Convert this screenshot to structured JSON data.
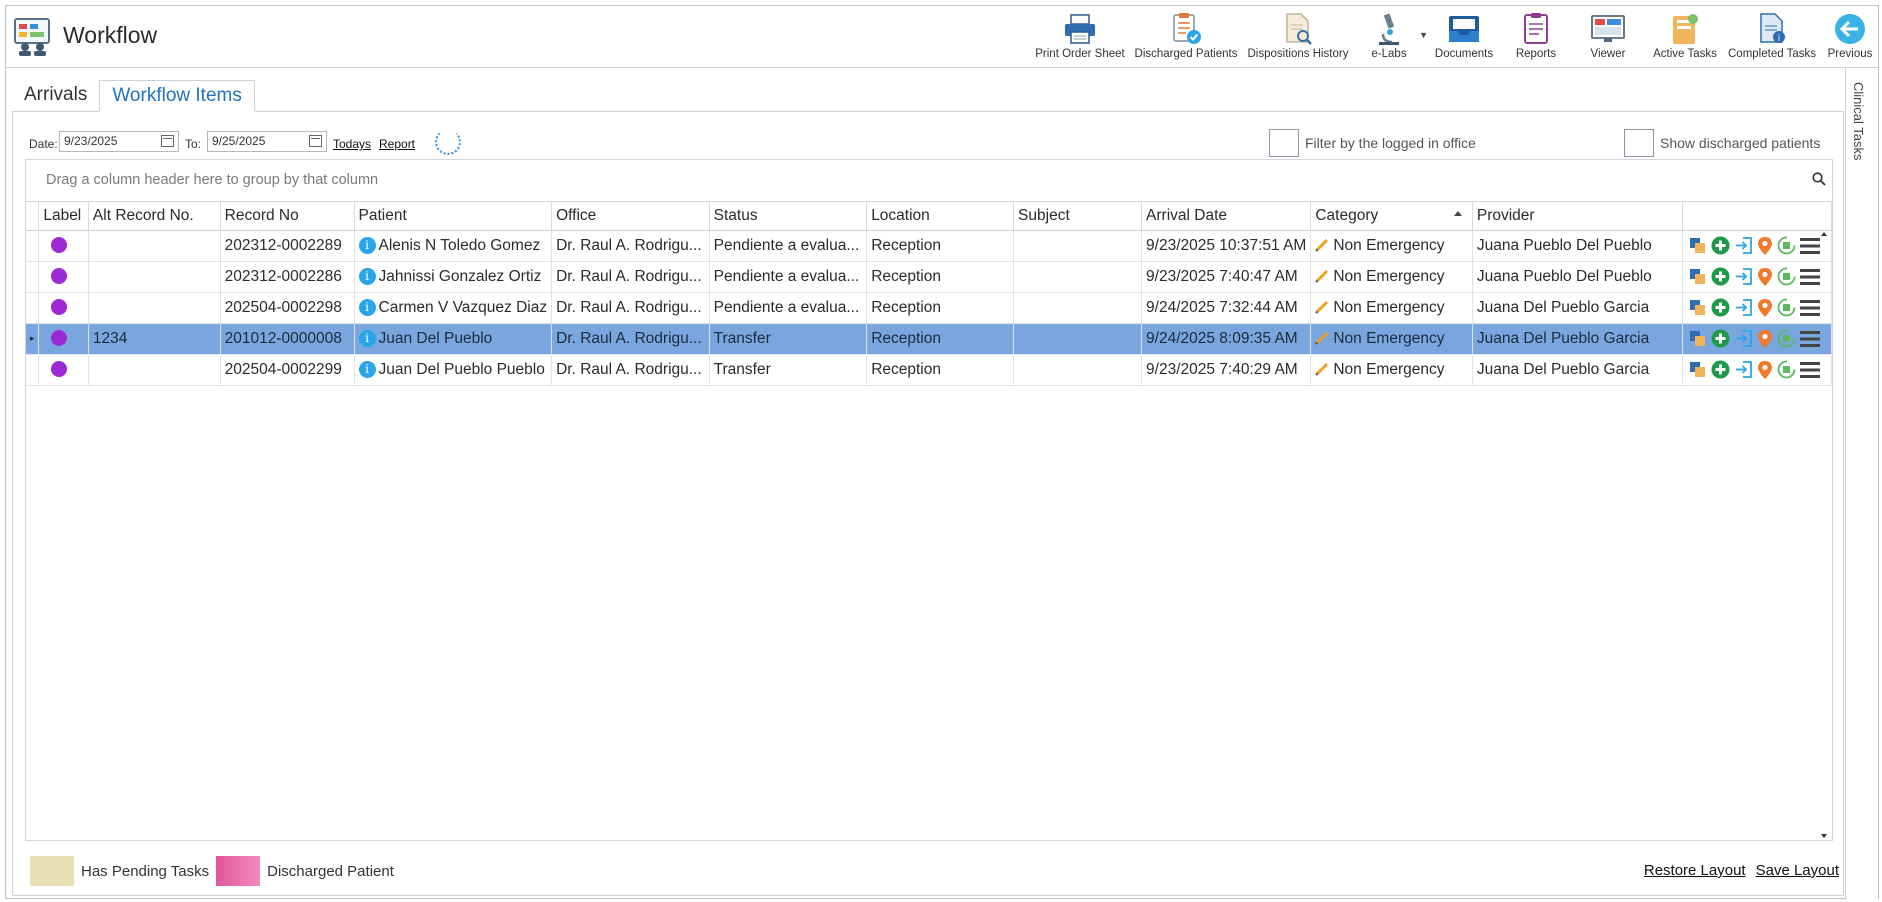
{
  "app": {
    "title": "Workflow"
  },
  "toolbar": [
    {
      "name": "print-order-sheet-button",
      "label": "Print Order Sheet",
      "icon": "printer-icon"
    },
    {
      "name": "discharged-patients-button",
      "label": "Discharged Patients",
      "icon": "clipboard-check-icon"
    },
    {
      "name": "dispositions-history-button",
      "label": "Dispositions History",
      "icon": "document-search-icon"
    },
    {
      "name": "e-labs-button",
      "label": "e-Labs",
      "icon": "microscope-icon"
    },
    {
      "name": "documents-button",
      "label": "Documents",
      "icon": "inbox-tray-icon"
    },
    {
      "name": "reports-button",
      "label": "Reports",
      "icon": "report-icon"
    },
    {
      "name": "viewer-button",
      "label": "Viewer",
      "icon": "monitor-icon"
    },
    {
      "name": "active-tasks-button",
      "label": "Active Tasks",
      "icon": "task-folder-icon"
    },
    {
      "name": "completed-tasks-button",
      "label": "Completed Tasks",
      "icon": "completed-doc-icon"
    },
    {
      "name": "previous-button",
      "label": "Previous",
      "icon": "back-arrow-icon"
    }
  ],
  "side_tab": {
    "label": "Clinical Tasks"
  },
  "tabs": [
    {
      "label": "Arrivals",
      "active": false
    },
    {
      "label": "Workflow Items",
      "active": true
    }
  ],
  "filters": {
    "date_label": "Date:",
    "date_from": "9/23/2025",
    "to_label": "To:",
    "date_to": "9/25/2025",
    "todays_link": "Todays",
    "report_link": "Report",
    "filter_office_label": "Filter by the logged in office",
    "show_discharged_label": "Show discharged patients"
  },
  "group_panel": {
    "placeholder": "Drag a column header here to group by that column"
  },
  "grid": {
    "columns": [
      "Label",
      "Alt Record No.",
      "Record No",
      "Patient",
      "Office",
      "Status",
      "Location",
      "Subject",
      "Arrival Date",
      "Category",
      "Provider"
    ],
    "rows": [
      {
        "alt_record": "",
        "record_no": "202312-0002289",
        "patient": "Alenis N Toledo Gomez",
        "office": "Dr. Raul A. Rodrigu...",
        "status": "Pendiente a evalua...",
        "location": "Reception",
        "subject": "",
        "arrival": "9/23/2025 10:37:51 AM",
        "category": "Non Emergency",
        "provider": "Juana Pueblo Del Pueblo",
        "selected": false
      },
      {
        "alt_record": "",
        "record_no": "202312-0002286",
        "patient": "Jahnissi Gonzalez Ortiz",
        "office": "Dr. Raul A. Rodrigu...",
        "status": "Pendiente a evalua...",
        "location": "Reception",
        "subject": "",
        "arrival": "9/23/2025 7:40:47 AM",
        "category": "Non Emergency",
        "provider": "Juana Pueblo Del Pueblo",
        "selected": false
      },
      {
        "alt_record": "",
        "record_no": "202504-0002298",
        "patient": "Carmen V Vazquez Diaz",
        "office": "Dr. Raul A. Rodrigu...",
        "status": "Pendiente a evalua...",
        "location": "Reception",
        "subject": "",
        "arrival": "9/24/2025 7:32:44 AM",
        "category": "Non Emergency",
        "provider": "Juana Del Pueblo Garcia",
        "selected": false
      },
      {
        "alt_record": "1234",
        "record_no": "201012-0000008",
        "patient": "Juan Del Pueblo",
        "office": "Dr. Raul A. Rodrigu...",
        "status": "Transfer",
        "location": "Reception",
        "subject": "",
        "arrival": "9/24/2025 8:09:35 AM",
        "category": "Non Emergency",
        "provider": "Juana Del Pueblo Garcia",
        "selected": true
      },
      {
        "alt_record": "",
        "record_no": "202504-0002299",
        "patient": "Juan Del Pueblo Pueblo",
        "office": "Dr. Raul A. Rodrigu...",
        "status": "Transfer",
        "location": "Reception",
        "subject": "",
        "arrival": "9/23/2025 7:40:29 AM",
        "category": "Non Emergency",
        "provider": "Juana Del Pueblo Garcia",
        "selected": false
      }
    ]
  },
  "legend": {
    "pending_label": "Has Pending Tasks",
    "discharged_label": "Discharged Patient"
  },
  "footer": {
    "restore_layout": "Restore Layout",
    "save_layout": "Save Layout"
  },
  "colors": {
    "accent": "#1f73c0",
    "label_dot": "#9b2ad4",
    "selected_row": "#7aa6e0",
    "pending_swatch": "#e8dfb4",
    "discharged_swatch": "#e2559a"
  }
}
